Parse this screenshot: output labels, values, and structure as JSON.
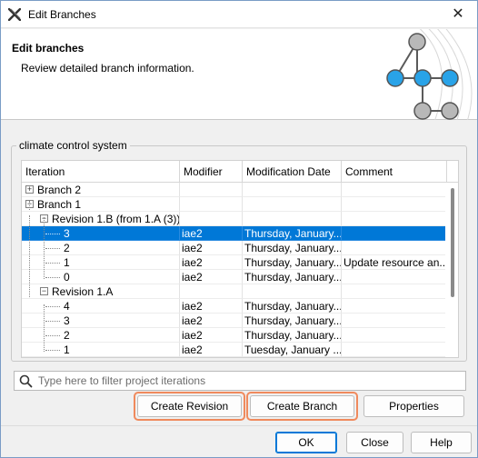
{
  "window": {
    "title": "Edit Branches",
    "close_glyph": "✕",
    "app_icon": "magicdraw-x-icon"
  },
  "header": {
    "title": "Edit branches",
    "subtitle": "Review detailed branch information."
  },
  "group": {
    "legend": "climate control system"
  },
  "table": {
    "columns": [
      "Iteration",
      "Modifier",
      "Modification Date",
      "Comment"
    ],
    "rows": [
      {
        "iteration": "Branch 2",
        "modifier": "",
        "date": "",
        "comment": ""
      },
      {
        "iteration": "Branch 1",
        "modifier": "",
        "date": "",
        "comment": ""
      },
      {
        "iteration": "Revision 1.B (from 1.A (3))",
        "modifier": "",
        "date": "",
        "comment": ""
      },
      {
        "iteration": "3",
        "modifier": "iae2",
        "date": "Thursday, January...",
        "comment": ""
      },
      {
        "iteration": "2",
        "modifier": "iae2",
        "date": "Thursday, January...",
        "comment": ""
      },
      {
        "iteration": "1",
        "modifier": "iae2",
        "date": "Thursday, January...",
        "comment": "Update resource an..."
      },
      {
        "iteration": "0",
        "modifier": "iae2",
        "date": "Thursday, January...",
        "comment": ""
      },
      {
        "iteration": "Revision 1.A",
        "modifier": "",
        "date": "",
        "comment": ""
      },
      {
        "iteration": "4",
        "modifier": "iae2",
        "date": "Thursday, January...",
        "comment": ""
      },
      {
        "iteration": "3",
        "modifier": "iae2",
        "date": "Thursday, January...",
        "comment": ""
      },
      {
        "iteration": "2",
        "modifier": "iae2",
        "date": "Thursday, January...",
        "comment": ""
      },
      {
        "iteration": "1",
        "modifier": "iae2",
        "date": "Tuesday, January ...",
        "comment": ""
      }
    ],
    "selected_row_index": 3
  },
  "filter": {
    "placeholder": "Type here to filter project iterations",
    "value": ""
  },
  "buttons": {
    "create_revision": "Create Revision",
    "create_branch": "Create Branch",
    "properties": "Properties",
    "ok": "OK",
    "close": "Close",
    "help": "Help"
  },
  "colors": {
    "selection": "#0078d7",
    "highlight_outline": "#f08a5d",
    "node_blue": "#29a3e8",
    "node_gray": "#b8b8b8"
  }
}
